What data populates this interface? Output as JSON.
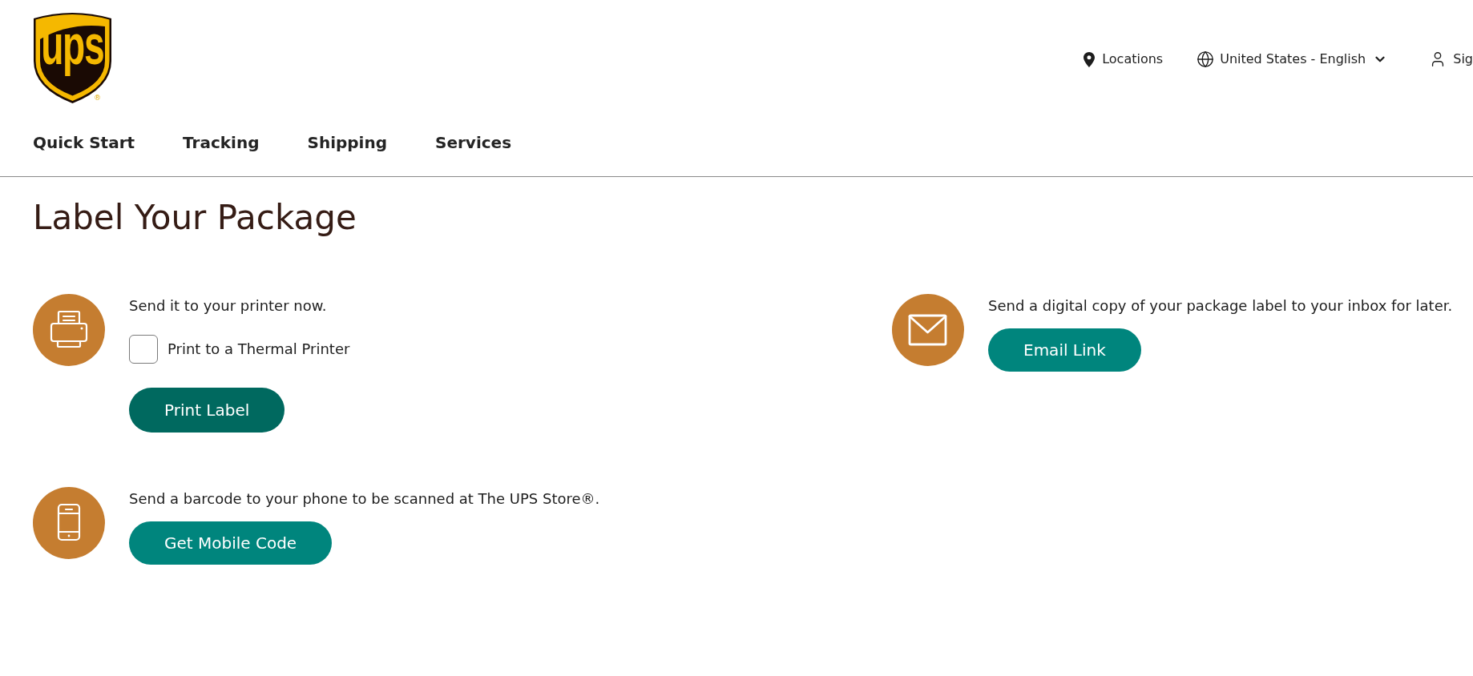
{
  "logo": {
    "text": "ups",
    "mark": "®"
  },
  "utility_nav": [
    {
      "kind": "location",
      "label": "Locations"
    },
    {
      "kind": "language",
      "label": "United States - English"
    },
    {
      "kind": "account",
      "label": "Sig"
    }
  ],
  "main_nav": [
    {
      "label": "Quick Start"
    },
    {
      "label": "Tracking"
    },
    {
      "label": "Shipping"
    },
    {
      "label": "Services"
    }
  ],
  "page_title": "Label Your Package",
  "options": [
    {
      "kind": "print",
      "description": "Send it to your printer now.",
      "checkbox": {
        "label": "Print to a Thermal Printer",
        "checked": false
      },
      "button": {
        "label": "Print Label",
        "hovered": true
      }
    },
    {
      "kind": "email",
      "description": "Send a digital copy of your package label to your inbox for later.",
      "button": {
        "label": "Email Link",
        "hovered": false
      }
    },
    {
      "kind": "mobile",
      "description": "Send a barcode to your phone to be scanned at The UPS Store®.",
      "button": {
        "label": "Get Mobile Code",
        "hovered": false
      }
    }
  ]
}
